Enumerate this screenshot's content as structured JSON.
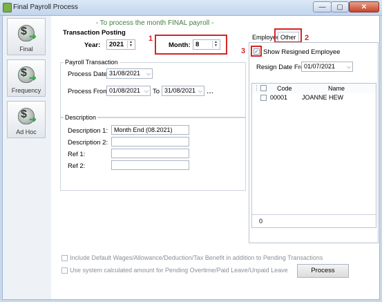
{
  "window": {
    "title": "Final Payroll Process",
    "min_glyph": "—",
    "max_glyph": "▢",
    "close_glyph": "✕"
  },
  "nav": [
    {
      "label": "Final",
      "icon": "money-bag-icon"
    },
    {
      "label": "Frequency",
      "icon": "money-bag-icon"
    },
    {
      "label": "Ad Hoc",
      "icon": "money-bag-icon"
    }
  ],
  "heading": "- To process the month FINAL payroll -",
  "posting": {
    "title": "Transaction Posting",
    "year_label": "Year:",
    "year_value": "2021",
    "month_label": "Month:",
    "month_value": "8"
  },
  "annotations": {
    "one": "1",
    "two": "2",
    "three": "3",
    "color": "#d52424"
  },
  "payroll_txn": {
    "title": "Payroll Transaction",
    "process_date_label": "Process Date:",
    "process_date": "31/08/2021",
    "process_from_label": "Process From:",
    "process_from": "01/08/2021",
    "to_label": "To",
    "process_to": "31/08/2021",
    "more": "..."
  },
  "description": {
    "title": "Description",
    "desc1_label": "Description 1:",
    "desc1_value": "Month End (08.2021)",
    "desc2_label": "Description 2:",
    "desc2_value": "",
    "ref1_label": "Ref 1:",
    "ref1_value": "",
    "ref2_label": "Ref 2:",
    "ref2_value": ""
  },
  "tabs": {
    "employee": "Employee",
    "other": "Other"
  },
  "other_panel": {
    "show_resigned_label": "Show Resigned Employee",
    "show_resigned_checked": true,
    "resign_date_label": "Resign Date From",
    "resign_date_value": "01/07/2021",
    "grid": {
      "columns": [
        "Code",
        "Name"
      ],
      "rows": [
        {
          "code": "00001",
          "name": "JOANNE HEW",
          "checked": false
        }
      ],
      "footer_count": "0"
    }
  },
  "options": {
    "include_default": "Include Default Wages/Allowance/Deduction/Tax Benefit in addition to Pending Transactions",
    "use_system": "Use system calculated amount for Pending Overtime/Paid Leave/Unpaid Leave"
  },
  "process_button": "Process"
}
